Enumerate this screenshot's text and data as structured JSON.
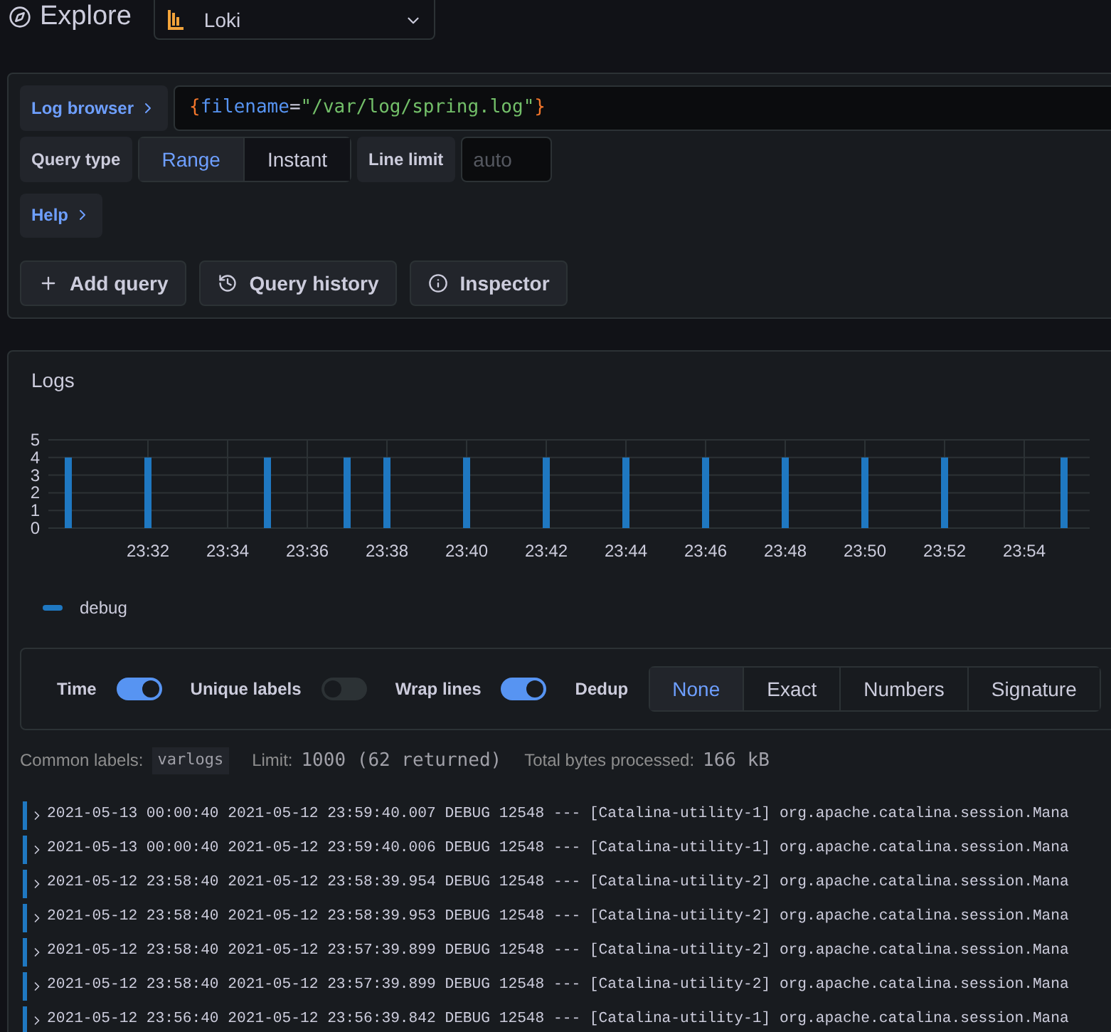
{
  "header": {
    "title": "Explore",
    "datasource": "Loki"
  },
  "query": {
    "log_browser": "Log browser",
    "expr_open": "{",
    "expr_key": "filename",
    "expr_eq": "=",
    "expr_value": "\"/var/log/spring.log\"",
    "expr_close": "}",
    "query_type_label": "Query type",
    "query_types": [
      {
        "label": "Range",
        "selected": true
      },
      {
        "label": "Instant",
        "selected": false
      }
    ],
    "line_limit_label": "Line limit",
    "line_limit": {
      "placeholder": "auto"
    },
    "help": "Help",
    "buttons": [
      {
        "kind": "add",
        "label": "Add query"
      },
      {
        "kind": "history",
        "label": "Query history"
      },
      {
        "kind": "info",
        "label": "Inspector"
      }
    ]
  },
  "logs": {
    "title": "Logs",
    "chart_data": {
      "type": "bar",
      "categories": [
        null,
        null,
        "23:32",
        null,
        "23:34",
        null,
        "23:36",
        null,
        "23:38",
        null,
        "23:40",
        null,
        "23:42",
        null,
        "23:44",
        null,
        "23:46",
        null,
        "23:48",
        null,
        "23:50",
        null,
        "23:52",
        null,
        "23:54",
        null
      ],
      "series": [
        {
          "name": "debug",
          "color": "#1f78c1",
          "values": [
            4,
            null,
            4,
            null,
            null,
            4,
            null,
            4,
            4,
            null,
            4,
            null,
            4,
            null,
            4,
            null,
            4,
            null,
            4,
            null,
            4,
            null,
            4,
            null,
            null,
            4
          ]
        }
      ],
      "ylim": [
        0,
        5
      ],
      "yticks": [
        0,
        1,
        2,
        3,
        4,
        5
      ],
      "grid": true
    },
    "toggles": [
      {
        "label": "Time",
        "on": true
      },
      {
        "label": "Unique labels",
        "on": false
      },
      {
        "label": "Wrap lines",
        "on": true
      }
    ],
    "dedup_label": "Dedup",
    "dedup": [
      {
        "label": "None",
        "selected": true
      },
      {
        "label": "Exact",
        "selected": false
      },
      {
        "label": "Numbers",
        "selected": false
      },
      {
        "label": "Signature",
        "selected": false
      }
    ],
    "meta": [
      {
        "label": "Common labels:",
        "value": "varlogs",
        "kind": "tag"
      },
      {
        "label": "Limit:",
        "value": "1000 (62 returned)",
        "kind": "text"
      },
      {
        "label": "Total bytes processed:",
        "value": "166 kB",
        "kind": "text"
      }
    ],
    "rows": [
      {
        "line": "2021-05-13 00:00:40 2021-05-12 23:59:40.007 DEBUG 12548 --- [Catalina-utility-1] org.apache.catalina.session.Mana",
        "color": "#1f78c1"
      },
      {
        "line": "2021-05-13 00:00:40 2021-05-12 23:59:40.006 DEBUG 12548 --- [Catalina-utility-1] org.apache.catalina.session.Mana",
        "color": "#1f78c1"
      },
      {
        "line": "2021-05-12 23:58:40 2021-05-12 23:58:39.954 DEBUG 12548 --- [Catalina-utility-2] org.apache.catalina.session.Mana",
        "color": "#1f78c1"
      },
      {
        "line": "2021-05-12 23:58:40 2021-05-12 23:58:39.953 DEBUG 12548 --- [Catalina-utility-2] org.apache.catalina.session.Mana",
        "color": "#1f78c1"
      },
      {
        "line": "2021-05-12 23:58:40 2021-05-12 23:57:39.899 DEBUG 12548 --- [Catalina-utility-2] org.apache.catalina.session.Mana",
        "color": "#1f78c1"
      },
      {
        "line": "2021-05-12 23:58:40 2021-05-12 23:57:39.899 DEBUG 12548 --- [Catalina-utility-2] org.apache.catalina.session.Mana",
        "color": "#1f78c1"
      },
      {
        "line": "2021-05-12 23:56:40 2021-05-12 23:56:39.842 DEBUG 12548 --- [Catalina-utility-1] org.apache.catalina.session.Mana",
        "color": "#1f78c1"
      }
    ]
  }
}
